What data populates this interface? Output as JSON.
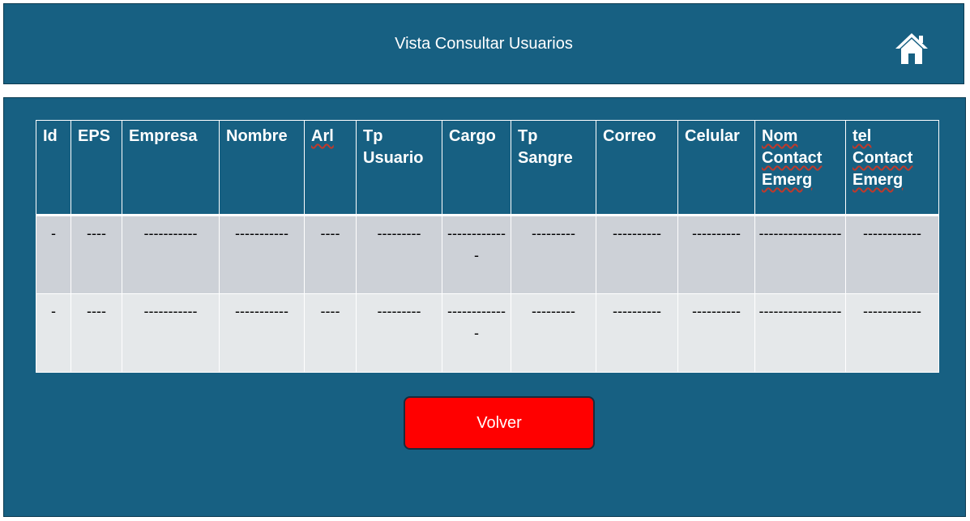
{
  "header": {
    "title": "Vista Consultar Usuarios",
    "home_icon": "home-icon"
  },
  "table": {
    "columns": [
      {
        "label": "Id",
        "underline": false
      },
      {
        "label": "EPS",
        "underline": false
      },
      {
        "label": "Empresa",
        "underline": false
      },
      {
        "label": "Nombre",
        "underline": false
      },
      {
        "label": "Arl",
        "underline": true
      },
      {
        "label": "Tp Usuario",
        "underline": false
      },
      {
        "label": "Cargo",
        "underline": false
      },
      {
        "label": "Tp Sangre",
        "underline": false
      },
      {
        "label": "Correo",
        "underline": false
      },
      {
        "label": "Celular",
        "underline": false
      },
      {
        "label": "Nom Contact Emerg",
        "underline": true
      },
      {
        "label": "tel Contact Emerg",
        "underline": true
      }
    ],
    "rows": [
      [
        "-",
        "----",
        "-----------",
        "-----------",
        "----",
        "---------",
        "-------------",
        "---------",
        "----------",
        "----------",
        "-----------------",
        "------------"
      ],
      [
        "-",
        "----",
        "-----------",
        "-----------",
        "----",
        "---------",
        "-------------",
        "---------",
        "----------",
        "----------",
        "-----------------",
        "------------"
      ]
    ]
  },
  "actions": {
    "volver_label": "Volver",
    "volver_color": "#ff0000"
  },
  "colors": {
    "panel": "#176082",
    "row_a": "#cdd1d7",
    "row_b": "#e5e8ea"
  }
}
